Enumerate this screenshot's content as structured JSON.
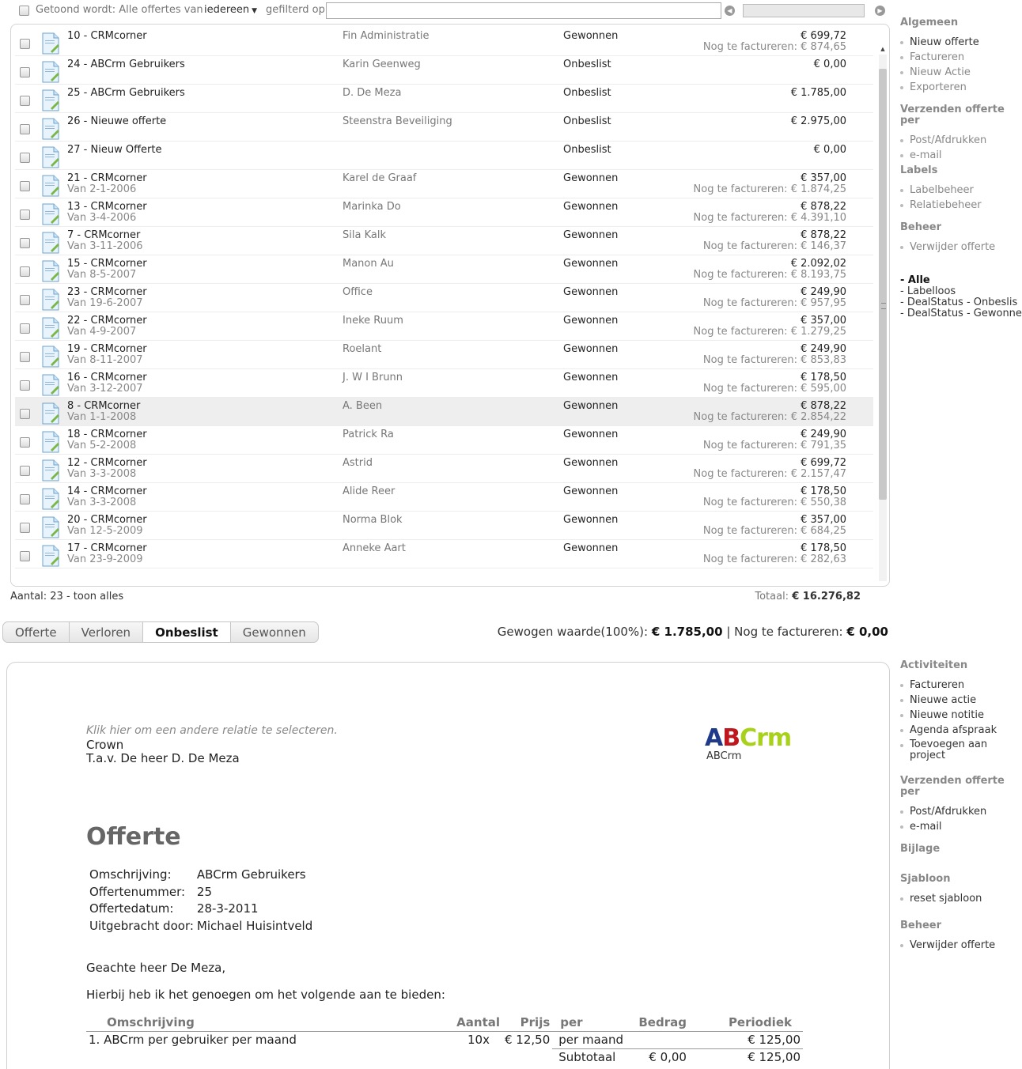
{
  "filter": {
    "shown_label": "Getoond wordt: Alle offertes van",
    "who": "iedereen",
    "filtered_label": "gefilterd op",
    "filter_value": "",
    "prev_icon": "arrow-left-icon",
    "next_icon": "arrow-right-icon"
  },
  "offers": [
    {
      "title": "10 - CRMcorner",
      "sub": "",
      "relation": "Fin Administratie",
      "status": "Gewonnen",
      "amount": "€ 699,72",
      "due": "Nog te factureren: € 874,65",
      "selected": false
    },
    {
      "title": "24 - ABCrm Gebruikers",
      "sub": "",
      "relation": "Karin Geenweg",
      "status": "Onbeslist",
      "amount": "€ 0,00",
      "due": "",
      "selected": false
    },
    {
      "title": "25 - ABCrm Gebruikers",
      "sub": "",
      "relation": "D. De Meza",
      "status": "Onbeslist",
      "amount": "€ 1.785,00",
      "due": "",
      "selected": false
    },
    {
      "title": "26 - Nieuwe offerte",
      "sub": "",
      "relation": "Steenstra Beveiliging",
      "status": "Onbeslist",
      "amount": "€ 2.975,00",
      "due": "",
      "selected": false
    },
    {
      "title": "27 - Nieuw Offerte",
      "sub": "",
      "relation": "",
      "status": "Onbeslist",
      "amount": "€ 0,00",
      "due": "",
      "selected": false
    },
    {
      "title": "21 - CRMcorner",
      "sub": "Van 2-1-2006",
      "relation": "Karel de Graaf",
      "status": "Gewonnen",
      "amount": "€ 357,00",
      "due": "Nog te factureren: € 1.874,25",
      "selected": false
    },
    {
      "title": "13 - CRMcorner",
      "sub": "Van 3-4-2006",
      "relation": "Marinka Do",
      "status": "Gewonnen",
      "amount": "€ 878,22",
      "due": "Nog te factureren: € 4.391,10",
      "selected": false
    },
    {
      "title": "7 - CRMcorner",
      "sub": "Van 3-11-2006",
      "relation": "Sila Kalk",
      "status": "Gewonnen",
      "amount": "€ 878,22",
      "due": "Nog te factureren: € 146,37",
      "selected": false
    },
    {
      "title": "15 - CRMcorner",
      "sub": "Van 8-5-2007",
      "relation": "Manon Au",
      "status": "Gewonnen",
      "amount": "€ 2.092,02",
      "due": "Nog te factureren: € 8.193,75",
      "selected": false
    },
    {
      "title": "23 - CRMcorner",
      "sub": "Van 19-6-2007",
      "relation": "Office",
      "status": "Gewonnen",
      "amount": "€ 249,90",
      "due": "Nog te factureren: € 957,95",
      "selected": false
    },
    {
      "title": "22 - CRMcorner",
      "sub": "Van 4-9-2007",
      "relation": "Ineke Ruum",
      "status": "Gewonnen",
      "amount": "€ 357,00",
      "due": "Nog te factureren: € 1.279,25",
      "selected": false
    },
    {
      "title": "19 - CRMcorner",
      "sub": "Van 8-11-2007",
      "relation": "Roelant",
      "status": "Gewonnen",
      "amount": "€ 249,90",
      "due": "Nog te factureren: € 853,83",
      "selected": false
    },
    {
      "title": "16 - CRMcorner",
      "sub": "Van 3-12-2007",
      "relation": "J. W I Brunn",
      "status": "Gewonnen",
      "amount": "€ 178,50",
      "due": "Nog te factureren: € 595,00",
      "selected": false
    },
    {
      "title": "8 - CRMcorner",
      "sub": "Van 1-1-2008",
      "relation": "A. Been",
      "status": "Gewonnen",
      "amount": "€ 878,22",
      "due": "Nog te factureren: € 2.854,22",
      "selected": true
    },
    {
      "title": "18 - CRMcorner",
      "sub": "Van 5-2-2008",
      "relation": "Patrick Ra",
      "status": "Gewonnen",
      "amount": "€ 249,90",
      "due": "Nog te factureren: € 791,35",
      "selected": false
    },
    {
      "title": "12 - CRMcorner",
      "sub": "Van 3-3-2008",
      "relation": "Astrid",
      "status": "Gewonnen",
      "amount": "€ 699,72",
      "due": "Nog te factureren: € 2.157,47",
      "selected": false
    },
    {
      "title": "14 - CRMcorner",
      "sub": "Van 3-3-2008",
      "relation": "Alide Reer",
      "status": "Gewonnen",
      "amount": "€ 178,50",
      "due": "Nog te factureren: € 550,38",
      "selected": false
    },
    {
      "title": "20 - CRMcorner",
      "sub": "Van 12-5-2009",
      "relation": "Norma Blok",
      "status": "Gewonnen",
      "amount": "€ 357,00",
      "due": "Nog te factureren: € 684,25",
      "selected": false
    },
    {
      "title": "17 - CRMcorner",
      "sub": "Van 23-9-2009",
      "relation": "Anneke Aart",
      "status": "Gewonnen",
      "amount": "€ 178,50",
      "due": "Nog te factureren: € 282,63",
      "selected": false
    }
  ],
  "list_footer": {
    "count": "Aantal: 23 - toon alles",
    "total_label": "Totaal:",
    "total_value": "€ 16.276,82"
  },
  "tabs": [
    {
      "label": "Offerte",
      "active": false
    },
    {
      "label": "Verloren",
      "active": false
    },
    {
      "label": "Onbeslist",
      "active": true
    },
    {
      "label": "Gewonnen",
      "active": false
    }
  ],
  "weighted": {
    "label": "Gewogen waarde(100%):",
    "value": "€ 1.785,00",
    "sep": "|",
    "due_label": "Nog te factureren:",
    "due_value": "€ 0,00"
  },
  "sidebar_top": {
    "algemeen": {
      "title": "Algemeen",
      "items": [
        "Nieuw offerte",
        "Factureren",
        "Nieuw Actie",
        "Exporteren"
      ]
    },
    "verzenden": {
      "title": "Verzenden offerte per",
      "items": [
        "Post/Afdrukken",
        "e-mail"
      ]
    },
    "labels": {
      "title": "Labels",
      "items": [
        "Labelbeheer",
        "Relatiebeheer"
      ]
    },
    "beheer": {
      "title": "Beheer",
      "items": [
        "Verwijder offerte"
      ]
    },
    "tags": [
      "- Alle",
      "- Labelloos",
      "- DealStatus - Onbeslis",
      "- DealStatus - Gewonne"
    ]
  },
  "sidebar_bottom": {
    "activiteiten": {
      "title": "Activiteiten",
      "items": [
        "Factureren",
        "Nieuwe actie",
        "Nieuwe notitie",
        "Agenda afspraak",
        "Toevoegen aan project"
      ]
    },
    "verzenden": {
      "title": "Verzenden offerte per",
      "items": [
        "Post/Afdrukken",
        "e-mail"
      ]
    },
    "bijlage": {
      "title": "Bijlage"
    },
    "sjabloon": {
      "title": "Sjabloon",
      "items": [
        "reset sjabloon"
      ]
    },
    "beheer": {
      "title": "Beheer",
      "items": [
        "Verwijder offerte"
      ]
    }
  },
  "document": {
    "select_hint": "Klik hier om een andere relatie te selecteren.",
    "company": "Crown",
    "attention": "T.a.v. De heer D. De Meza",
    "logo_text": "ABCrm",
    "logo_sub": "ABCrm",
    "logo_colors": {
      "A": "#1f3a8a",
      "B": "#c0161d",
      "Crm": "#a8d11a"
    },
    "title": "Offerte",
    "meta": [
      {
        "label": "Omschrijving:",
        "value": "ABCrm Gebruikers"
      },
      {
        "label": "Offertenummer:",
        "value": "25"
      },
      {
        "label": "Offertedatum:",
        "value": "28-3-2011"
      },
      {
        "label": "Uitgebracht door:",
        "value": "Michael Huisintveld"
      }
    ],
    "greeting": "Geachte heer De Meza,",
    "intro": "Hierbij heb ik het genoegen om het volgende aan te bieden:",
    "columns": [
      "Omschrijving",
      "Aantal",
      "Prijs",
      "per",
      "Bedrag",
      "Periodiek"
    ],
    "lines": [
      {
        "desc": "1. ABCrm per gebruiker per maand",
        "qty": "10x",
        "price": "€ 12,50",
        "per": "per maand",
        "amount": "",
        "periodic": "€ 125,00"
      }
    ],
    "subtotal": {
      "label": "Subtotaal",
      "amount": "€ 0,00",
      "periodic": "€ 125,00"
    }
  }
}
